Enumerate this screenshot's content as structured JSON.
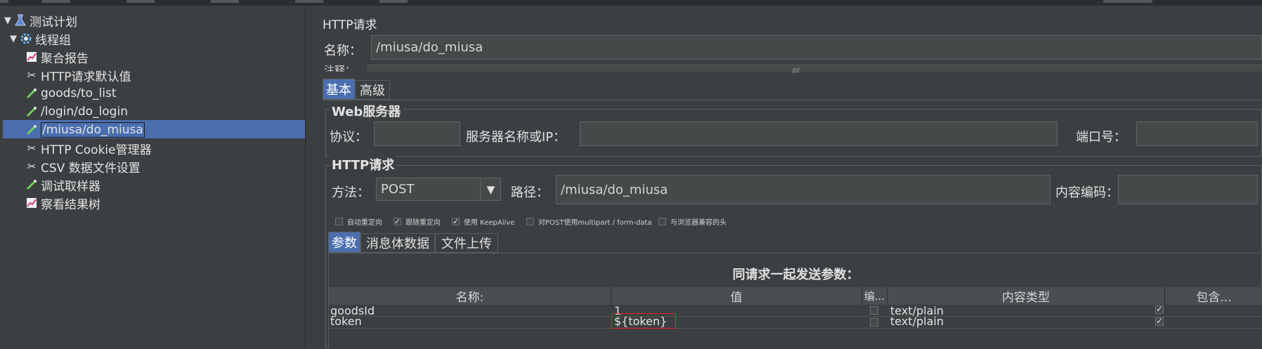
{
  "tree": {
    "items": [
      {
        "label": "测试计划",
        "icon": "test-plan-flask-icon"
      },
      {
        "label": "线程组",
        "icon": "thread-group-gear-icon"
      },
      {
        "label": "聚合报告",
        "icon": "report-chart-icon"
      },
      {
        "label": "HTTP请求默认值",
        "icon": "config-scissors-icon"
      },
      {
        "label": "goods/to_list",
        "icon": "sampler-pipette-icon"
      },
      {
        "label": "/login/do_login",
        "icon": "sampler-pipette-icon"
      },
      {
        "label": "/miusa/do_miusa",
        "icon": "sampler-pipette-icon"
      },
      {
        "label": "HTTP Cookie管理器",
        "icon": "config-scissors-icon"
      },
      {
        "label": "CSV 数据文件设置",
        "icon": "config-scissors-icon"
      },
      {
        "label": "调试取样器",
        "icon": "sampler-pipette-icon"
      },
      {
        "label": "察看结果树",
        "icon": "listener-chart-icon"
      }
    ]
  },
  "panel": {
    "title": "HTTP请求",
    "name_label": "名称：",
    "name_value": "/miusa/do_miusa",
    "comment_label": "注释：",
    "tabs": [
      "基本",
      "高级"
    ],
    "web_server": {
      "title": "Web服务器",
      "protocol_label": "协议：",
      "protocol_value": "",
      "server_label": "服务器名称或IP：",
      "server_value": "",
      "port_label": "端口号：",
      "port_value": ""
    },
    "http_request": {
      "title": "HTTP请求",
      "method_label": "方法：",
      "method_value": "POST",
      "path_label": "路径：",
      "path_value": "/miusa/do_miusa",
      "encoding_label": "内容编码：",
      "encoding_value": ""
    },
    "options": [
      {
        "label": "自动重定向",
        "checked": false
      },
      {
        "label": "跟随重定向",
        "checked": true
      },
      {
        "label": "使用 KeepAlive",
        "checked": true
      },
      {
        "label": "对POST使用multipart / form-data",
        "checked": false
      },
      {
        "label": "与浏览器兼容的头",
        "checked": false
      }
    ],
    "sub_tabs": [
      "参数",
      "消息体数据",
      "文件上传"
    ],
    "params": {
      "caption": "同请求一起发送参数：",
      "columns": [
        "名称:",
        "值",
        "编...",
        "内容类型",
        "包含..."
      ],
      "rows": [
        {
          "name": "goodsId",
          "value": "1",
          "encode": false,
          "content_type": "text/plain",
          "include": true
        },
        {
          "name": "token",
          "value": "${token}",
          "encode": false,
          "content_type": "text/plain",
          "include": true
        }
      ]
    }
  },
  "colors": {
    "background": "#3c3f41",
    "selection": "#4b6eaf",
    "highlight_box": "#e0262a"
  }
}
